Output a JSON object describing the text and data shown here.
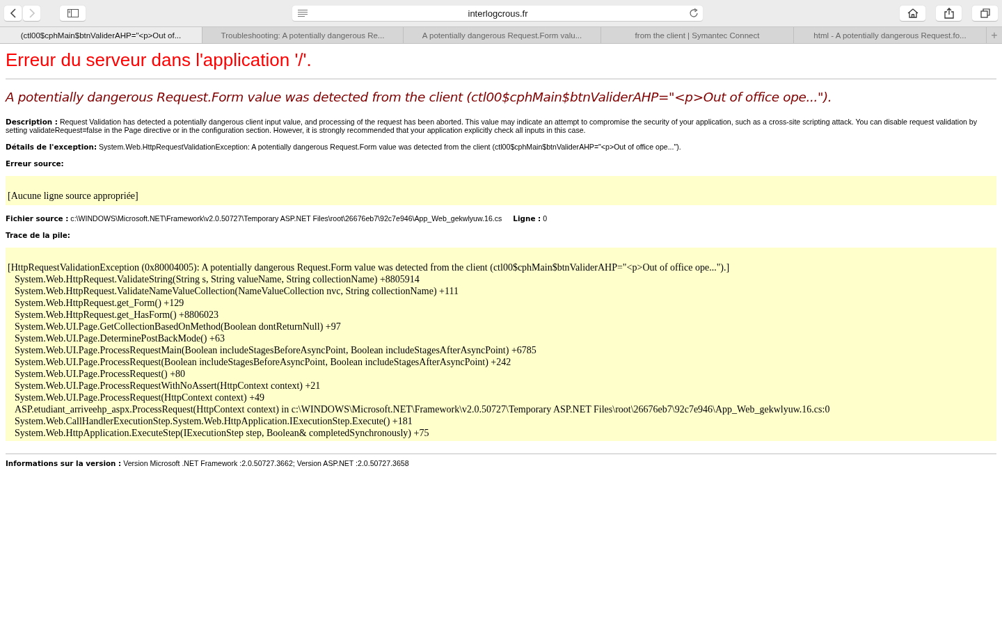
{
  "browser": {
    "back_disabled": false,
    "forward_disabled": true,
    "address": "interlogcrous.fr",
    "tabs": [
      {
        "label": "(ctl00$cphMain$btnValiderAHP=\"<p>Out of...",
        "selected": true
      },
      {
        "label": "Troubleshooting: A potentially dangerous Re...",
        "selected": false
      },
      {
        "label": "A potentially dangerous Request.Form valu...",
        "selected": false
      },
      {
        "label": "from the client | Symantec Connect",
        "selected": false
      },
      {
        "label": "html - A potentially dangerous Request.fo...",
        "selected": false
      }
    ],
    "new_tab": "+"
  },
  "page": {
    "title": "Erreur du serveur dans l'application '/'.",
    "subtitle": "A potentially dangerous Request.Form value was detected from the client (ctl00$cphMain$btnValiderAHP=\"<p>Out of office ope...\").",
    "description": "**Description :** Request Validation has detected a potentially dangerous client input value, and processing of the request has been aborted. This value may indicate an attempt to compromise the security of your application, such as a cross-site scripting attack. You can disable request validation by setting validateRequest=false in the Page directive or in the configuration section. However, it is strongly recommended that your application explicitly check all inputs in this case.",
    "exception_details": "**Détails de l'exception:** System.Web.HttpRequestValidationException: A potentially dangerous Request.Form value was detected from the client (ctl00$cphMain$btnValiderAHP=\"<p>Out of office ope...\").",
    "source_error_label": "Erreur source:",
    "source_error": "[Aucune ligne source appropriée]",
    "source_file": "**Fichier source :** c:\\WINDOWS\\Microsoft.NET\\Framework\\v2.0.50727\\Temporary ASP.NET Files\\root\\26676eb7\\92c7e946\\App_Web_gekwlyuw.16.cs",
    "line": "**Ligne :** 0",
    "stack_label": "Trace de la pile:",
    "stack_header": "[HttpRequestValidationException (0x80004005): A potentially dangerous Request.Form value was detected from the client (ctl00$cphMain$btnValiderAHP=\"<p>Out of office ope...\").]",
    "stack_frames": [
      "System.Web.HttpRequest.ValidateString(String s, String valueName, String collectionName) +8805914",
      "System.Web.HttpRequest.ValidateNameValueCollection(NameValueCollection nvc, String collectionName) +111",
      "System.Web.HttpRequest.get_Form() +129",
      "System.Web.HttpRequest.get_HasForm() +8806023",
      "System.Web.UI.Page.GetCollectionBasedOnMethod(Boolean dontReturnNull) +97",
      "System.Web.UI.Page.DeterminePostBackMode() +63",
      "System.Web.UI.Page.ProcessRequestMain(Boolean includeStagesBeforeAsyncPoint, Boolean includeStagesAfterAsyncPoint) +6785",
      "System.Web.UI.Page.ProcessRequest(Boolean includeStagesBeforeAsyncPoint, Boolean includeStagesAfterAsyncPoint) +242",
      "System.Web.UI.Page.ProcessRequest() +80",
      "System.Web.UI.Page.ProcessRequestWithNoAssert(HttpContext context) +21",
      "System.Web.UI.Page.ProcessRequest(HttpContext context) +49",
      "ASP.etudiant_arriveehp_aspx.ProcessRequest(HttpContext context) in c:\\WINDOWS\\Microsoft.NET\\Framework\\v2.0.50727\\Temporary ASP.NET Files\\root\\26676eb7\\92c7e946\\App_Web_gekwlyuw.16.cs:0",
      "System.Web.CallHandlerExecutionStep.System.Web.HttpApplication.IExecutionStep.Execute() +181",
      "System.Web.HttpApplication.ExecuteStep(IExecutionStep step, Boolean& completedSynchronously) +75"
    ],
    "version": "**Informations sur la version :** Version Microsoft .NET Framework :2.0.50727.3662; Version ASP.NET :2.0.50727.3658"
  }
}
